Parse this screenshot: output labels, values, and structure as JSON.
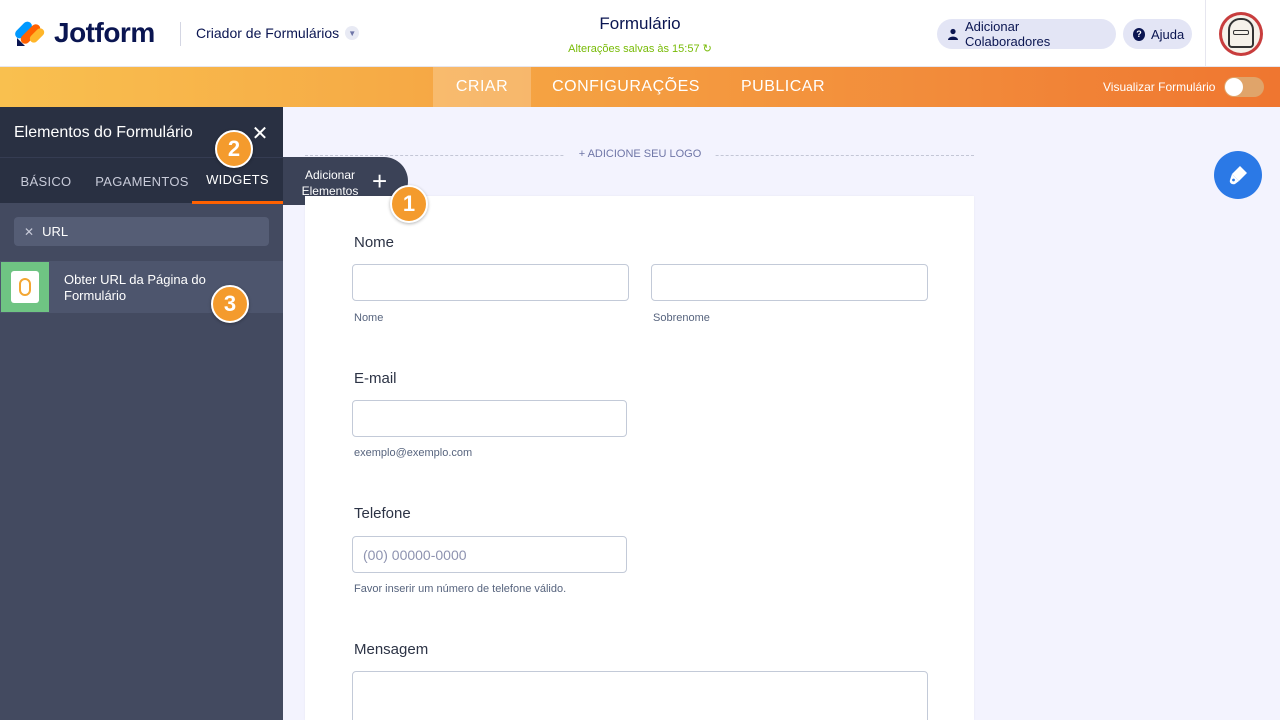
{
  "header": {
    "brand": "Jotform",
    "builder_label": "Criador de Formulários",
    "form_title": "Formulário",
    "saved_status": "Alterações salvas às 15:57 ↻",
    "collaborators_label": "Adicionar Colaboradores",
    "help_label": "Ajuda"
  },
  "nav": {
    "tabs": [
      "CRIAR",
      "CONFIGURAÇÕES",
      "PUBLICAR"
    ],
    "active_tab": "CRIAR",
    "preview_label": "Visualizar Formulário",
    "preview_enabled": false
  },
  "panel": {
    "title": "Elementos do Formulário",
    "close_glyph": "✕",
    "tabs": [
      "BÁSICO",
      "PAGAMENTOS",
      "WIDGETS"
    ],
    "active_tab": "WIDGETS",
    "search_value": "URL",
    "results": [
      {
        "name": "Obter URL da Página do Formulário"
      }
    ]
  },
  "add_elements": {
    "label": "Adicionar Elementos",
    "glyph": "+"
  },
  "steps": [
    "1",
    "2",
    "3"
  ],
  "canvas": {
    "logo_prompt": "+ ADICIONE SEU LOGO",
    "fields": {
      "name": {
        "label": "Nome",
        "first_sub": "Nome",
        "last_sub": "Sobrenome"
      },
      "email": {
        "label": "E-mail",
        "sub": "exemplo@exemplo.com"
      },
      "phone": {
        "label": "Telefone",
        "placeholder": "(00) 00000-0000",
        "sub": "Favor inserir um número de telefone válido."
      },
      "message": {
        "label": "Mensagem"
      }
    }
  },
  "colors": {
    "brand_navy": "#0a1551",
    "accent_orange": "#ff6100",
    "saved_green": "#78bb07",
    "panel_dark": "#293042",
    "panel_bg": "#434a60",
    "designer_blue": "#2b79e6",
    "step_badge": "#f49b2d"
  },
  "icons": {
    "collaborators": "user-icon",
    "help": "help-circle-icon",
    "designer": "paint-brush-icon",
    "search_clear": "clear-x-icon"
  }
}
